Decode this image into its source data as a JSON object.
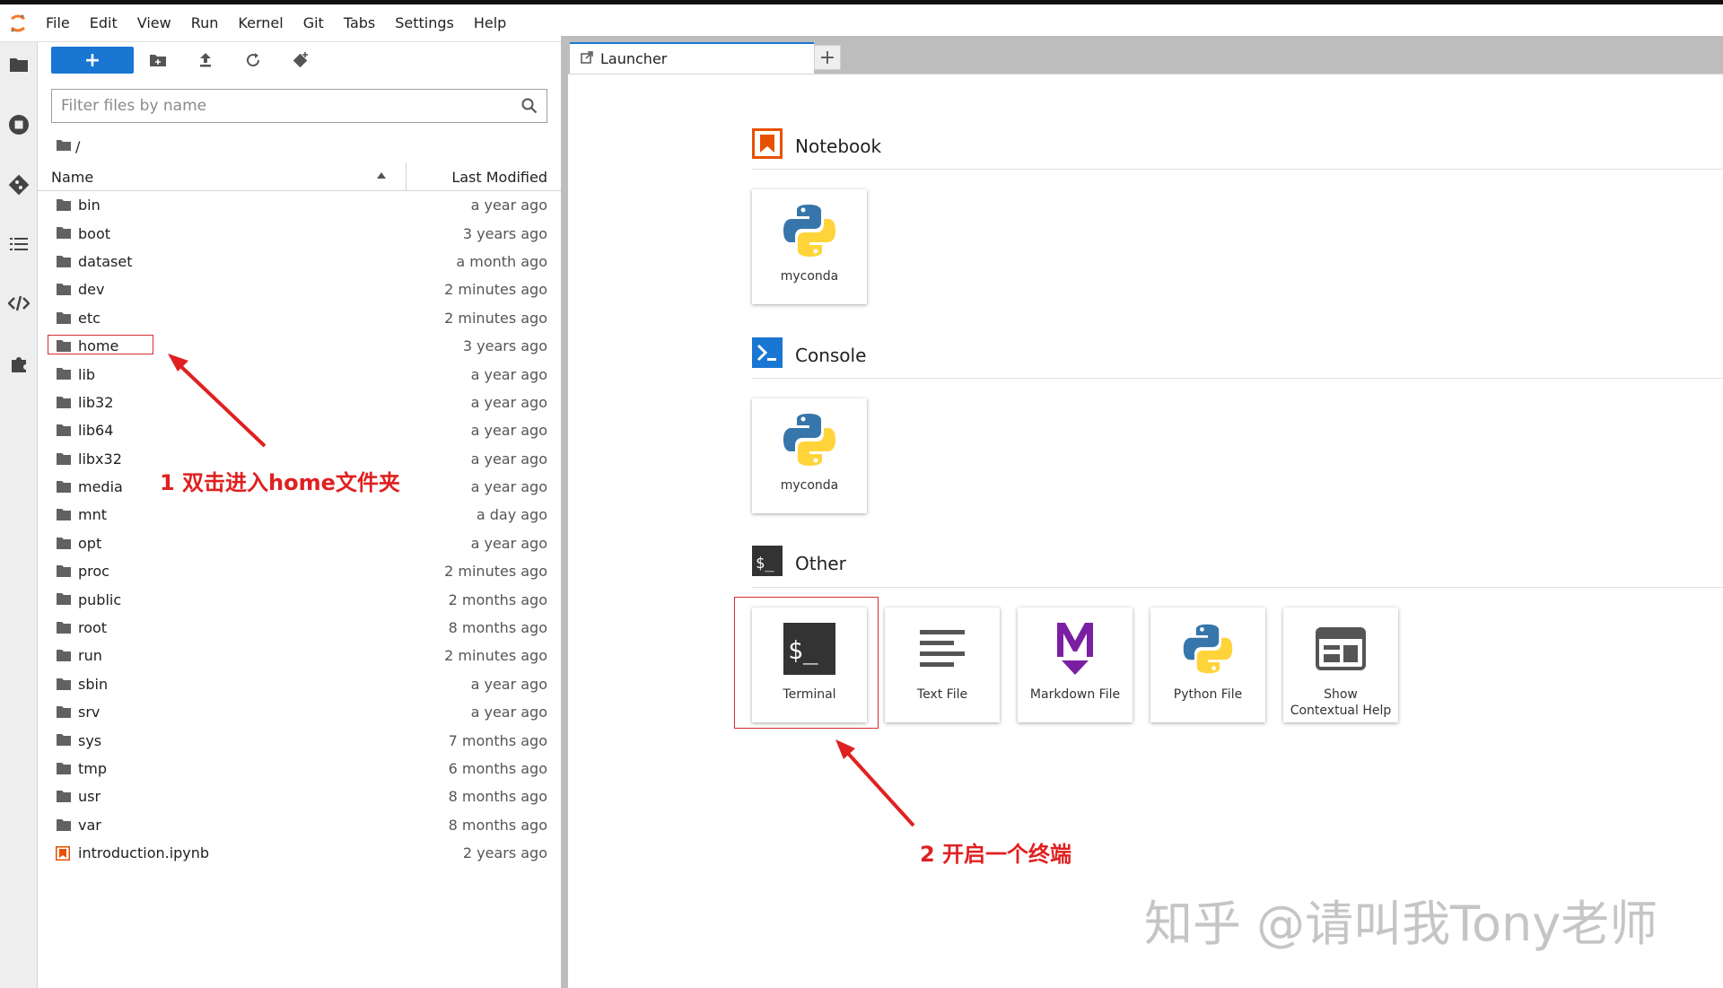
{
  "menubar": {
    "items": [
      "File",
      "Edit",
      "View",
      "Run",
      "Kernel",
      "Git",
      "Tabs",
      "Settings",
      "Help"
    ]
  },
  "sidebar": {
    "icons": [
      "folder-icon",
      "running-icon",
      "git-icon",
      "toc-icon",
      "code-icon",
      "extension-icon"
    ]
  },
  "filebrowser": {
    "new_label": "+",
    "filter_placeholder": "Filter files by name",
    "breadcrumb": "/",
    "col_name": "Name",
    "col_modified": "Last Modified",
    "files": [
      {
        "name": "bin",
        "modified": "a year ago",
        "type": "folder"
      },
      {
        "name": "boot",
        "modified": "3 years ago",
        "type": "folder"
      },
      {
        "name": "dataset",
        "modified": "a month ago",
        "type": "folder"
      },
      {
        "name": "dev",
        "modified": "2 minutes ago",
        "type": "folder"
      },
      {
        "name": "etc",
        "modified": "2 minutes ago",
        "type": "folder"
      },
      {
        "name": "home",
        "modified": "3 years ago",
        "type": "folder"
      },
      {
        "name": "lib",
        "modified": "a year ago",
        "type": "folder"
      },
      {
        "name": "lib32",
        "modified": "a year ago",
        "type": "folder"
      },
      {
        "name": "lib64",
        "modified": "a year ago",
        "type": "folder"
      },
      {
        "name": "libx32",
        "modified": "a year ago",
        "type": "folder"
      },
      {
        "name": "media",
        "modified": "a year ago",
        "type": "folder"
      },
      {
        "name": "mnt",
        "modified": "a day ago",
        "type": "folder"
      },
      {
        "name": "opt",
        "modified": "a year ago",
        "type": "folder"
      },
      {
        "name": "proc",
        "modified": "2 minutes ago",
        "type": "folder"
      },
      {
        "name": "public",
        "modified": "2 months ago",
        "type": "folder"
      },
      {
        "name": "root",
        "modified": "8 months ago",
        "type": "folder"
      },
      {
        "name": "run",
        "modified": "2 minutes ago",
        "type": "folder"
      },
      {
        "name": "sbin",
        "modified": "a year ago",
        "type": "folder"
      },
      {
        "name": "srv",
        "modified": "a year ago",
        "type": "folder"
      },
      {
        "name": "sys",
        "modified": "7 months ago",
        "type": "folder"
      },
      {
        "name": "tmp",
        "modified": "6 months ago",
        "type": "folder"
      },
      {
        "name": "usr",
        "modified": "8 months ago",
        "type": "folder"
      },
      {
        "name": "var",
        "modified": "8 months ago",
        "type": "folder"
      },
      {
        "name": "introduction.ipynb",
        "modified": "2 years ago",
        "type": "notebook"
      }
    ]
  },
  "tabs": {
    "launcher_label": "Launcher",
    "add_label": "+"
  },
  "launcher": {
    "notebook_title": "Notebook",
    "console_title": "Console",
    "other_title": "Other",
    "notebook_card": "myconda",
    "console_card": "myconda",
    "other_cards": [
      "Terminal",
      "Text File",
      "Markdown File",
      "Python File",
      "Show Contextual Help"
    ]
  },
  "annotations": {
    "step1": "1 双击进入home文件夹",
    "step2": "2 开启一个终端"
  },
  "watermark": "知乎 @请叫我Tony老师",
  "colors": {
    "accent": "#1976d2",
    "annotation": "#e02020",
    "notebook_orange": "#e65100",
    "markdown_purple": "#7b1fa2"
  }
}
